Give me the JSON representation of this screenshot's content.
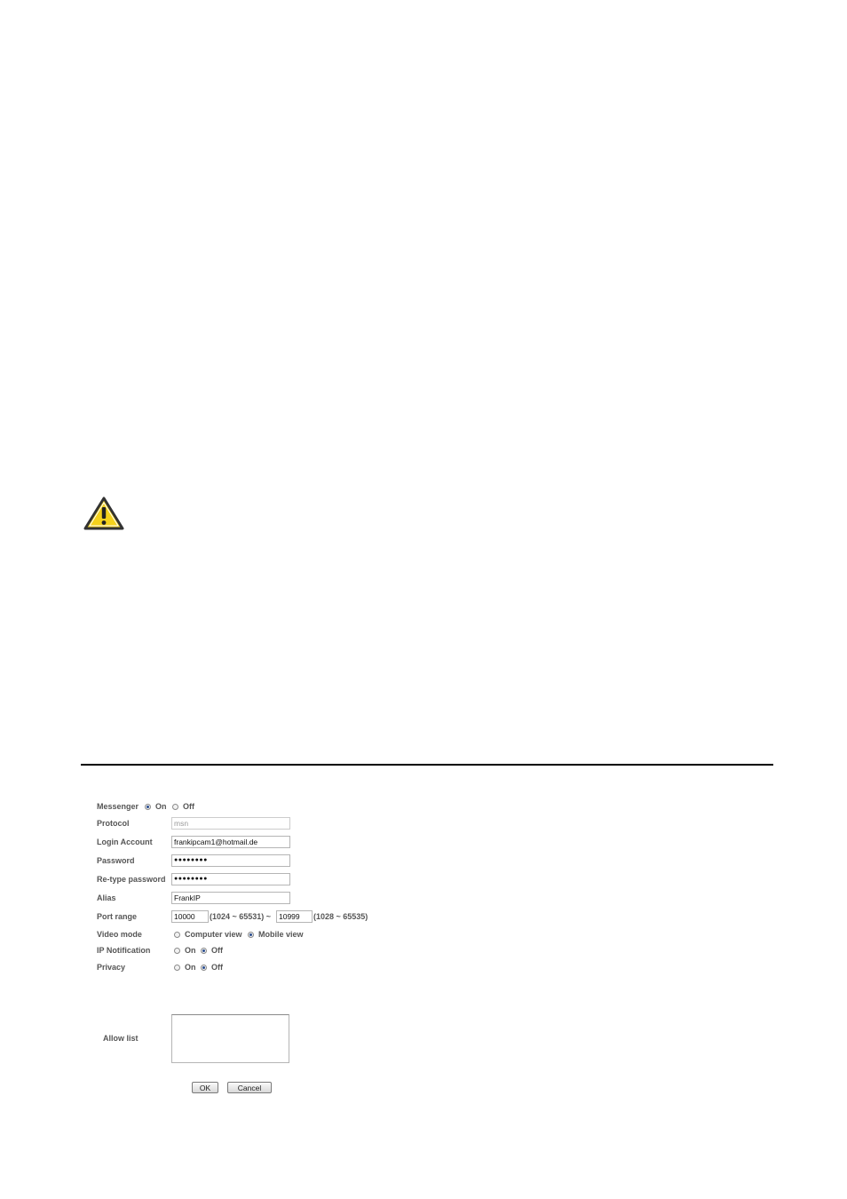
{
  "messenger": {
    "label": "Messenger",
    "on_label": "On",
    "off_label": "Off",
    "selected": "On"
  },
  "protocol": {
    "label": "Protocol",
    "value": "msn"
  },
  "login_account": {
    "label": "Login Account",
    "value": "frankipcam1@hotmail.de"
  },
  "password": {
    "label": "Password",
    "value": "●●●●●●●●"
  },
  "retype_password": {
    "label": "Re-type password",
    "value": "●●●●●●●●"
  },
  "alias": {
    "label": "Alias",
    "value": "FrankIP"
  },
  "port_range": {
    "label": "Port range",
    "from": "10000",
    "from_hint": "(1024 ~ 65531) ~",
    "to": "10999",
    "to_hint": "(1028 ~ 65535)"
  },
  "video_mode": {
    "label": "Video mode",
    "option_computer": "Computer view",
    "option_mobile": "Mobile view",
    "selected": "Mobile view"
  },
  "ip_notification": {
    "label": "IP Notification",
    "on_label": "On",
    "off_label": "Off",
    "selected": "Off"
  },
  "privacy": {
    "label": "Privacy",
    "on_label": "On",
    "off_label": "Off",
    "selected": "Off"
  },
  "allow_list": {
    "label": "Allow list",
    "value": ""
  },
  "buttons": {
    "ok": "OK",
    "cancel": "Cancel"
  },
  "icons": {
    "warning": "warning-triangle-icon"
  },
  "colors": {
    "warning_fill": "#f5d21c",
    "warning_border": "#333333",
    "radio_selected": "#2a4d8f"
  }
}
